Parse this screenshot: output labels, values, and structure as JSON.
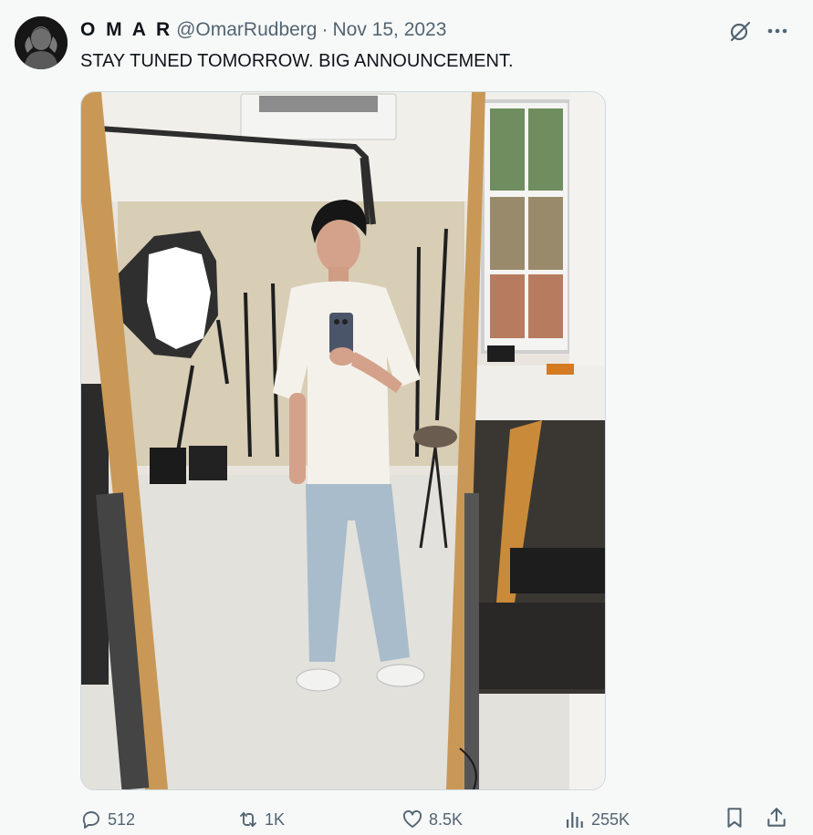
{
  "tweet": {
    "author_name": "O M A R",
    "handle": "@OmarRudberg",
    "separator": "·",
    "date": "Nov 15, 2023",
    "text": "STAY TUNED TOMORROW. BIG ANNOUNCEMENT."
  },
  "icons": {
    "grok": "grok-icon",
    "more": "more-icon",
    "reply": "reply-icon",
    "retweet": "retweet-icon",
    "like": "heart-icon",
    "views": "views-icon",
    "bookmark": "bookmark-icon",
    "share": "share-icon"
  },
  "actions": {
    "replies": "512",
    "retweets": "1K",
    "likes": "8.5K",
    "views": "255K"
  },
  "colors": {
    "text_primary": "#0f1419",
    "text_secondary": "#536471",
    "background": "#f7f9f9"
  }
}
